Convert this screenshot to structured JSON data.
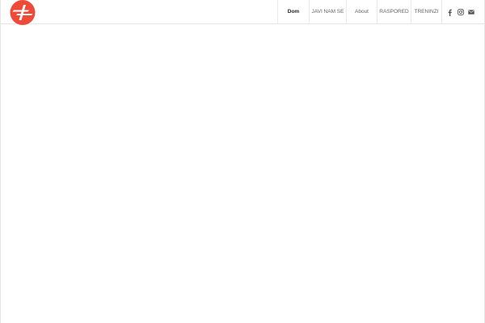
{
  "header": {
    "logo": {
      "name": "logo-mark",
      "color": "#ee4a37"
    },
    "nav": {
      "items": [
        {
          "label": "Dom",
          "active": true
        },
        {
          "label": "JAVI NAM SE",
          "active": false
        },
        {
          "label": "About",
          "active": false
        },
        {
          "label": "RASPORED",
          "active": false
        },
        {
          "label": "TRENINZI",
          "active": false
        }
      ]
    },
    "social": {
      "icons": [
        "facebook-icon",
        "instagram-icon",
        "mail-icon"
      ],
      "color": "#555555"
    }
  },
  "colors": {
    "accent": "#ee4a37",
    "text": "#666666",
    "text_active": "#222222",
    "border": "#e4e4e4"
  }
}
